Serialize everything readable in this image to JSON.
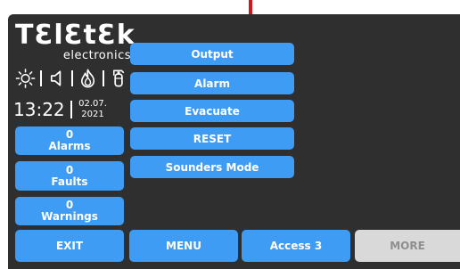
{
  "logo": {
    "brand": "TƐlƐtƐk",
    "subtitle": "electronics"
  },
  "status_icons": [
    "sun-icon",
    "speaker-icon",
    "fire-icon",
    "fire-extinguisher-icon"
  ],
  "clock": {
    "time": "13:22",
    "date_line1": "02.07.",
    "date_line2": "2021"
  },
  "counters": [
    {
      "count": "0",
      "label": "Alarms"
    },
    {
      "count": "0",
      "label": "Faults"
    },
    {
      "count": "0",
      "label": "Warnings"
    }
  ],
  "menu": {
    "output": "Output",
    "alarm": "Alarm",
    "evacuate": "Evacuate",
    "reset": "RESET",
    "sounders_mode": "Sounders Mode"
  },
  "bottom_bar": {
    "exit": "EXIT",
    "menu": "MENU",
    "access": "Access 3",
    "more": "MORE"
  },
  "colors": {
    "screen_bg": "#2f2f2f",
    "button_blue": "#3f9cf5",
    "button_disabled": "#d9d9d9",
    "disabled_text": "#8f8f8f",
    "arrow_red": "#d8141c"
  }
}
